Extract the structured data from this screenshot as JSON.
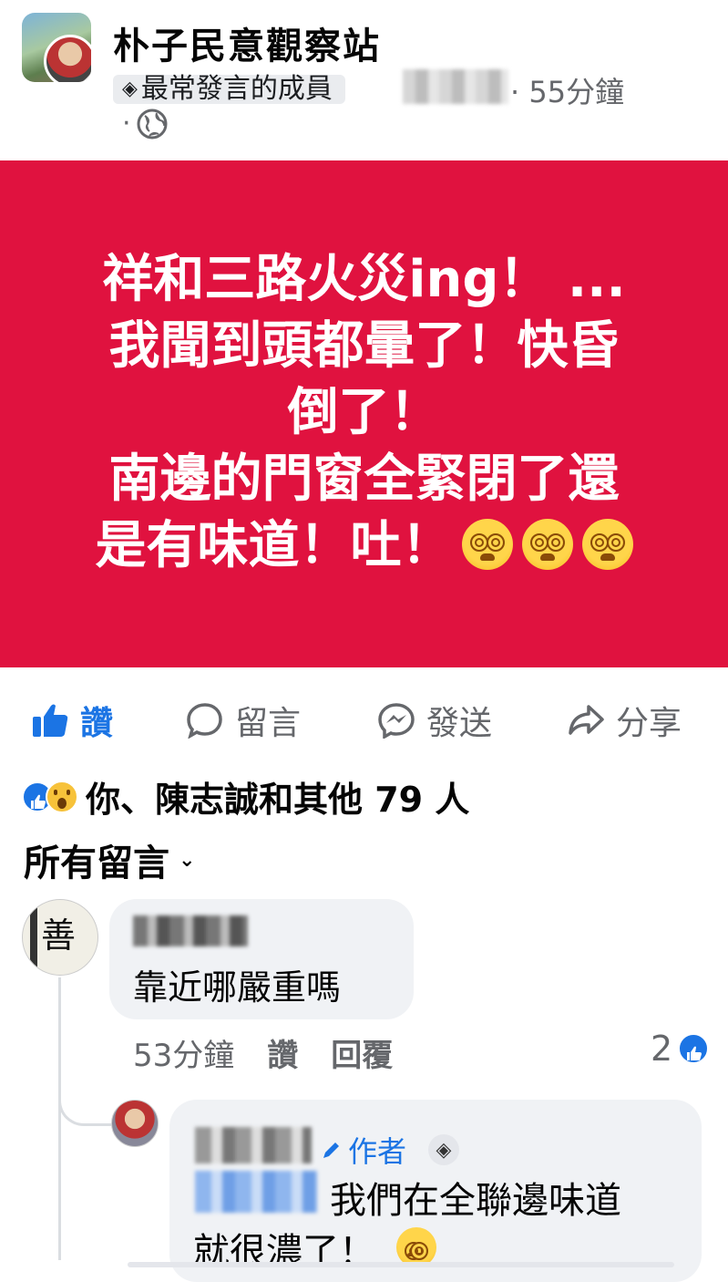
{
  "post": {
    "group_name": "朴子民意觀察站",
    "badge": "最常發言的成員",
    "time": "· 55分鐘",
    "dot": "·",
    "banner_lines": [
      "祥和三路火災ing！ ...",
      "我聞到頭都暈了！快昏",
      "倒了！",
      "南邊的門窗全緊閉了還",
      "是有味道！吐！"
    ],
    "banner_color": "#e0123f"
  },
  "actions": {
    "like": "讚",
    "comment": "留言",
    "send": "發送",
    "share": "分享",
    "like_color": "#1b74e4"
  },
  "reactions": {
    "summary": "你、陳志誠和其他 79 人"
  },
  "comments_header": {
    "label": "所有留言",
    "chevron": "⌄"
  },
  "comments": [
    {
      "text": "靠近哪嚴重嗎",
      "time": "53分鐘",
      "like": "讚",
      "reply": "回覆",
      "like_count": "2",
      "avatar_glyph": "善"
    }
  ],
  "reply": {
    "author_label": "作者",
    "text_line1": "我們在全聯邊味道",
    "text_line2": "就很濃了！"
  }
}
